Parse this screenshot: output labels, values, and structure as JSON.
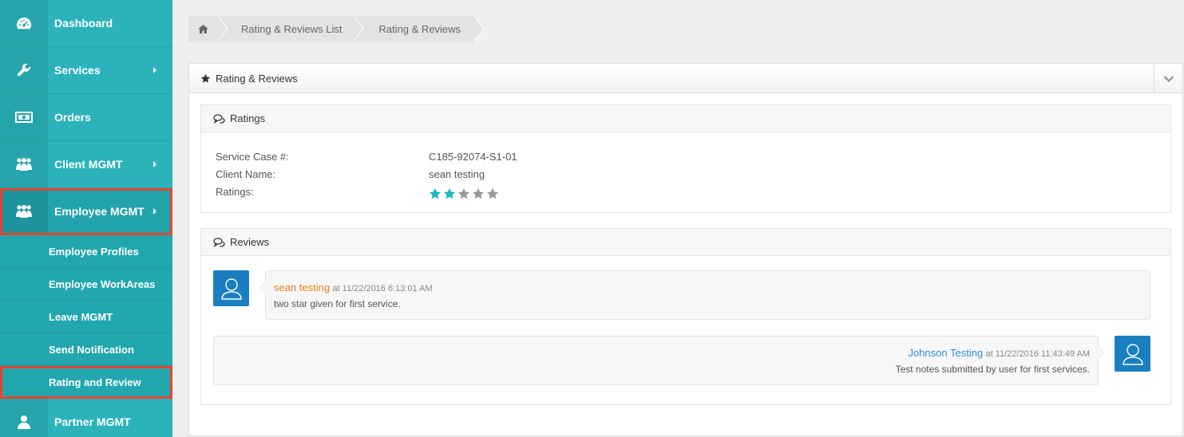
{
  "colors": {
    "sidebar": "#2cb2ba",
    "highlight": "#e8452e",
    "star_filled": "#1fb5c2",
    "star_empty": "#999999",
    "avatar": "#1a7fc1",
    "reviewer_primary": "#e8821a",
    "reviewer_secondary": "#2a8fd0"
  },
  "sidebar": {
    "items": [
      {
        "label": "Dashboard",
        "icon": "dashboard-icon"
      },
      {
        "label": "Services",
        "icon": "wrench-icon"
      },
      {
        "label": "Orders",
        "icon": "money-icon"
      },
      {
        "label": "Client MGMT",
        "icon": "users-icon"
      },
      {
        "label": "Employee MGMT",
        "icon": "users-icon"
      },
      {
        "label": "Partner MGMT",
        "icon": "user-icon"
      }
    ],
    "employee_subitems": [
      {
        "label": "Employee Profiles"
      },
      {
        "label": "Employee WorkAreas"
      },
      {
        "label": "Leave MGMT"
      },
      {
        "label": "Send Notification"
      },
      {
        "label": "Rating and Review"
      }
    ]
  },
  "breadcrumb": {
    "home_icon": "home-icon",
    "items": [
      "Rating & Reviews List",
      "Rating & Reviews"
    ]
  },
  "panel": {
    "title": "Rating & Reviews",
    "title_icon": "star-icon",
    "toggle_icon": "chevron-down-icon"
  },
  "ratings": {
    "title": "Ratings",
    "rows": [
      {
        "key": "Service Case #:",
        "value": "C185-92074-S1-01"
      },
      {
        "key": "Client Name:",
        "value": "sean testing"
      },
      {
        "key": "Ratings:",
        "value": ""
      }
    ],
    "stars_filled": 2,
    "stars_total": 5
  },
  "reviews": {
    "title": "Reviews",
    "items": [
      {
        "author": "sean testing",
        "at": "at 11/22/2016 6:13:01 AM",
        "text": "two star given for first service."
      },
      {
        "author": "Johnson Testing",
        "at": "at 11/22/2016 11:43:49 AM",
        "text": "Test notes submitted by user for first services."
      }
    ]
  }
}
